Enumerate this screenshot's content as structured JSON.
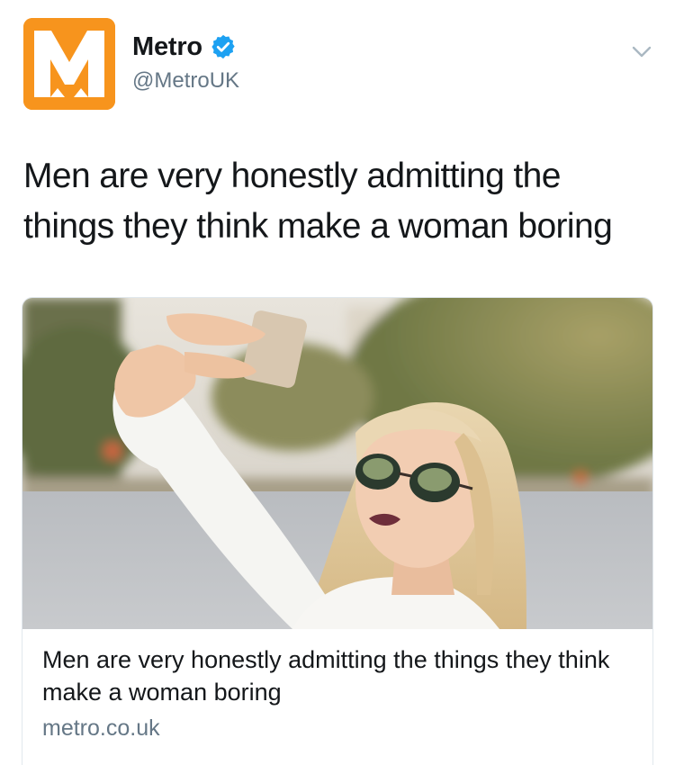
{
  "tweet": {
    "author": {
      "display_name": "Metro",
      "handle": "@MetroUK",
      "verified": true,
      "avatar_letter": "M",
      "avatar_color": "#f7941d"
    },
    "text": "Men are very honestly admitting the things they think make a woman boring",
    "menu_icon": "chevron-down-icon"
  },
  "card": {
    "image_alt": "Woman with sunglasses taking a selfie",
    "title": "Men are very honestly admitting the things they think make a woman boring",
    "domain": "metro.co.uk"
  },
  "colors": {
    "verified_blue": "#1da1f2",
    "text": "#14171a",
    "secondary": "#657786",
    "border": "#e1e8ed"
  }
}
